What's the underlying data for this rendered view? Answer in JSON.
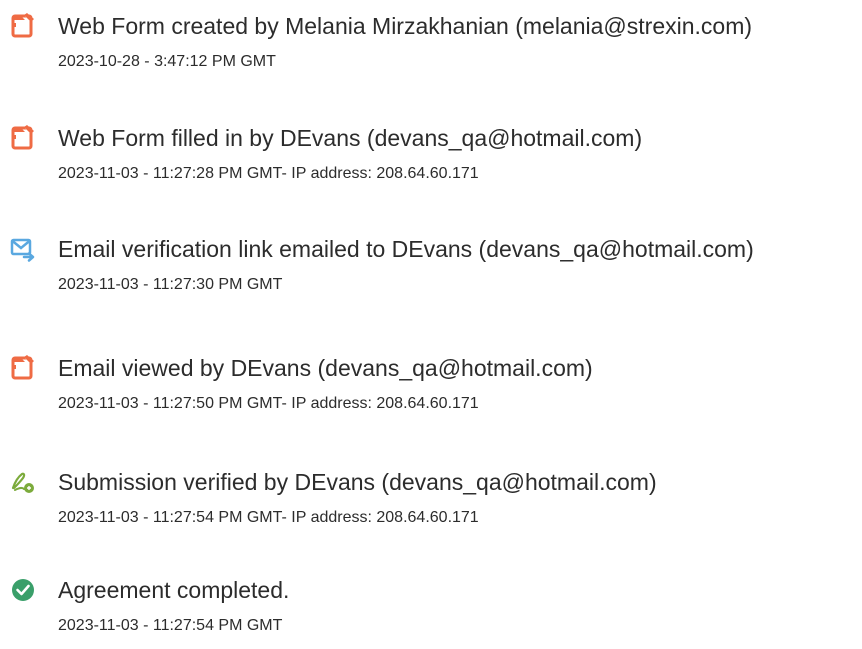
{
  "audit_trail": {
    "events": [
      {
        "icon": "document-edit-icon",
        "title": "Web Form created by Melania Mirzakhanian (melania@strexin.com)",
        "meta": "2023-10-28 - 3:47:12 PM GMT"
      },
      {
        "icon": "document-edit-icon",
        "title": "Web Form filled in by DEvans (devans_qa@hotmail.com)",
        "meta": "2023-11-03 - 11:27:28 PM GMT- IP address: 208.64.60.171"
      },
      {
        "icon": "email-send-icon",
        "title": "Email verification link emailed to DEvans (devans_qa@hotmail.com)",
        "meta": "2023-11-03 - 11:27:30 PM GMT"
      },
      {
        "icon": "document-edit-icon",
        "title": "Email viewed by DEvans (devans_qa@hotmail.com)",
        "meta": "2023-11-03 - 11:27:50 PM GMT- IP address: 208.64.60.171"
      },
      {
        "icon": "signature-verified-icon",
        "title": "Submission verified by DEvans (devans_qa@hotmail.com)",
        "meta": "2023-11-03 - 11:27:54 PM GMT- IP address: 208.64.60.171"
      },
      {
        "icon": "check-circle-icon",
        "title": "Agreement completed.",
        "meta": "2023-11-03 - 11:27:54 PM GMT"
      }
    ]
  },
  "colors": {
    "text": "#2c2c2c",
    "document_icon": "#ef6b44",
    "email_icon": "#5aa8e0",
    "signature_icon": "#7cab3c",
    "check_icon": "#3a9f6a"
  }
}
